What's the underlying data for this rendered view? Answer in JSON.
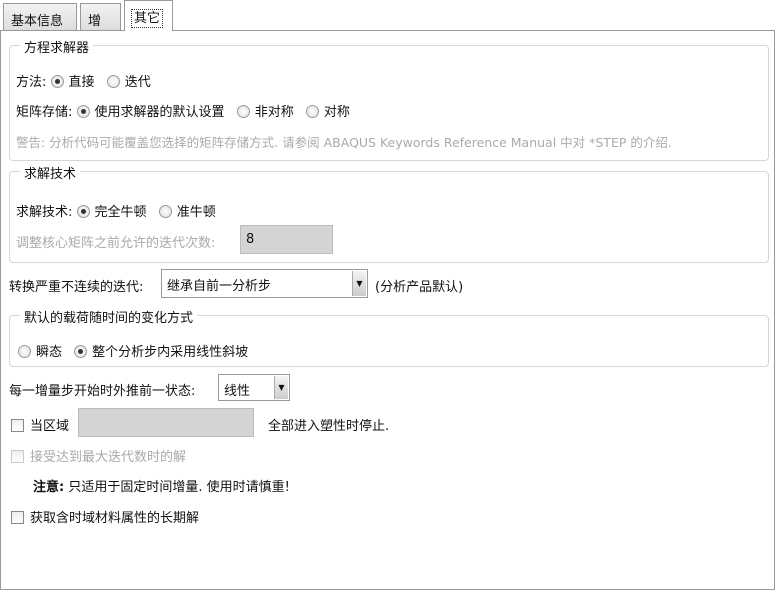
{
  "tabs": [
    "基本信息",
    "增量",
    "其它"
  ],
  "solver": {
    "legend": "方程求解器",
    "method_label": "方法:",
    "method_options": [
      "直接",
      "迭代"
    ],
    "storage_label": "矩阵存储:",
    "storage_options": [
      "使用求解器的默认设置",
      "非对称",
      "对称"
    ],
    "warning": "警告: 分析代码可能覆盖您选择的矩阵存储方式. 请参阅 ABAQUS Keywords Reference Manual 中对 *STEP 的介绍."
  },
  "technique": {
    "legend": "求解技术",
    "label": "求解技术:",
    "options": [
      "完全牛顿",
      "准牛顿"
    ],
    "iter_label": "调整核心矩阵之前允许的迭代次数:",
    "iter_value": "8"
  },
  "discontinuous": {
    "label": "转换严重不连续的迭代:",
    "value": "继承自前一分析步",
    "note": "(分析产品默认)"
  },
  "load": {
    "legend": "默认的载荷随时间的变化方式",
    "options": [
      "瞬态",
      "整个分析步内采用线性斜坡"
    ]
  },
  "extrapolation": {
    "label": "每一增量步开始时外推前一状态:",
    "value": "线性"
  },
  "stop": {
    "label": "当区域",
    "value": "",
    "suffix": "全部进入塑性时停止."
  },
  "accept": {
    "label": "接受达到最大迭代数时的解"
  },
  "note": {
    "title": "注意:",
    "text": "只适用于固定时间增量. 使用时请慎重!"
  },
  "longterm": {
    "label": "获取含时域材料属性的长期解"
  }
}
